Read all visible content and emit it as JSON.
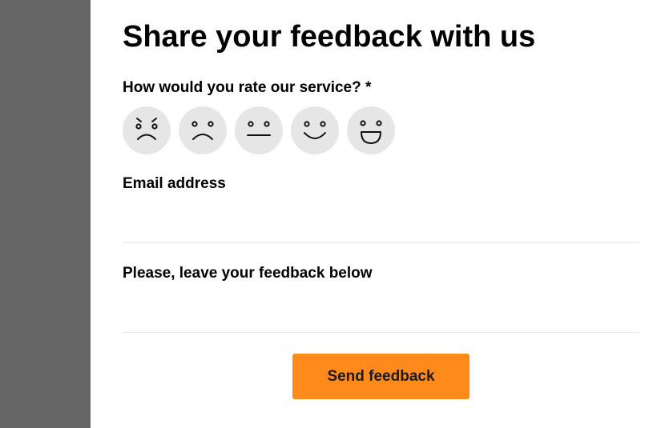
{
  "form": {
    "title": "Share your feedback with us",
    "rating_label": "How would you rate our service? *",
    "rating_options": [
      {
        "icon": "angry-face-icon"
      },
      {
        "icon": "sad-face-icon"
      },
      {
        "icon": "neutral-face-icon"
      },
      {
        "icon": "smiling-face-icon"
      },
      {
        "icon": "grinning-face-icon"
      }
    ],
    "email_label": "Email address",
    "email_value": "",
    "feedback_label": "Please, leave your feedback below",
    "feedback_value": "",
    "submit_label": "Send feedback"
  },
  "colors": {
    "sidebar": "#666666",
    "face_background": "#e6e6e6",
    "face_stroke": "#111111",
    "button": "#ff8a1c",
    "divider": "#e6e6e6"
  }
}
